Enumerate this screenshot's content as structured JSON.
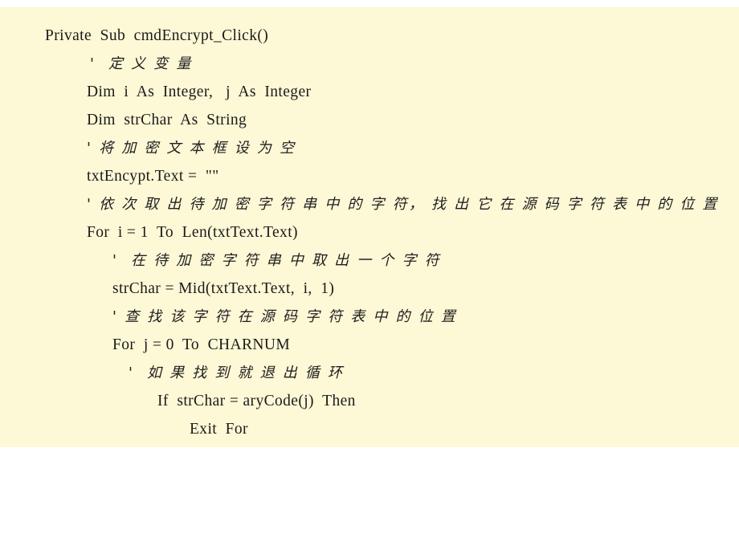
{
  "slide": {
    "background_color": "#ffffff",
    "panel_color": "#fdf8d6",
    "text_color": "#1a1a1a",
    "code_lines": [
      {
        "text": "Private  Sub  cmdEncrypt_Click()",
        "indent": 0,
        "chinese": false
      },
      {
        "text": "'  定 义 变 量",
        "indent": 1,
        "chinese": true
      },
      {
        "text": "Dim  i  As  Integer,   j  As  Integer",
        "indent": 2,
        "chinese": false
      },
      {
        "text": "Dim  strChar  As  String",
        "indent": 2,
        "chinese": false
      },
      {
        "text": "' 将 加 密 文 本 框 设 为 空",
        "indent": 2,
        "chinese": true
      },
      {
        "text": "txtEncypt.Text =  \"\"",
        "indent": 2,
        "chinese": false
      },
      {
        "text": "' 依 次 取 出 待 加 密 字 符 串 中 的 字 符， 找 出 它 在 源 码 字 符 表 中 的 位 置",
        "indent": 2,
        "chinese": true
      },
      {
        "text": "For  i = 1  To  Len(txtText.Text)",
        "indent": 2,
        "chinese": false
      },
      {
        "text": "'  在 待 加 密 字 符 串 中 取 出 一 个 字 符",
        "indent": 3,
        "chinese": true
      },
      {
        "text": "strChar = Mid(txtText.Text,  i,  1)",
        "indent": 3,
        "chinese": false
      },
      {
        "text": "' 查 找 该 字 符 在 源 码 字 符 表 中 的 位 置",
        "indent": 3,
        "chinese": true
      },
      {
        "text": "For  j = 0  To  CHARNUM",
        "indent": 3,
        "chinese": false
      },
      {
        "text": "'  如 果 找 到 就 退 出 循 环",
        "indent": 4,
        "chinese": true
      },
      {
        "text": "If  strChar = aryCode(j)  Then",
        "indent": 5,
        "chinese": false
      },
      {
        "text": "Exit  For",
        "indent": 6,
        "chinese": false
      }
    ]
  }
}
